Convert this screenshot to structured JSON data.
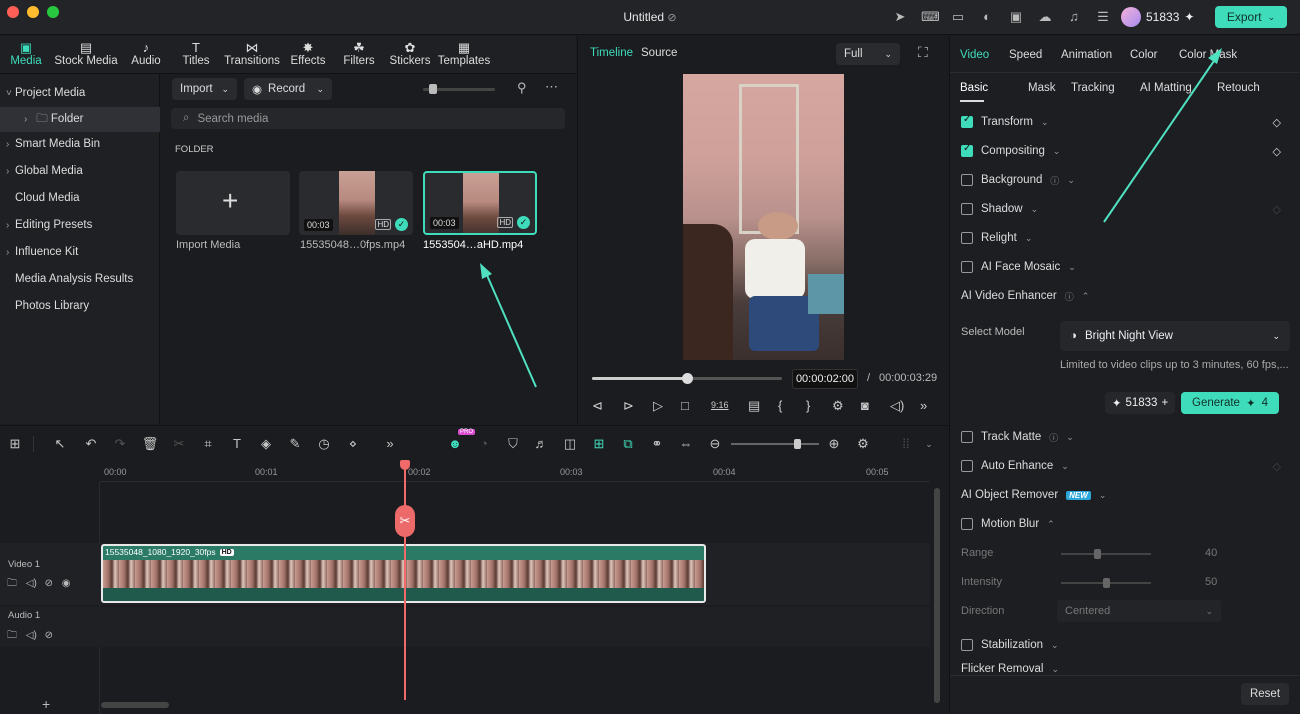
{
  "window": {
    "title": "Untitled",
    "credits": "51833",
    "export_label": "Export"
  },
  "media_tabs": [
    {
      "label": "Media",
      "icon": "media-icon"
    },
    {
      "label": "Stock Media",
      "icon": "stock-media-icon"
    },
    {
      "label": "Audio",
      "icon": "audio-icon"
    },
    {
      "label": "Titles",
      "icon": "titles-icon"
    },
    {
      "label": "Transitions",
      "icon": "transitions-icon"
    },
    {
      "label": "Effects",
      "icon": "effects-icon"
    },
    {
      "label": "Filters",
      "icon": "filters-icon"
    },
    {
      "label": "Stickers",
      "icon": "stickers-icon"
    },
    {
      "label": "Templates",
      "icon": "templates-icon"
    }
  ],
  "left_nav": [
    {
      "label": "Project Media",
      "caret": "˅"
    },
    {
      "label": "Folder",
      "caret": "›"
    },
    {
      "label": "Smart Media Bin",
      "caret": "›"
    },
    {
      "label": "Global Media",
      "caret": "›"
    },
    {
      "label": "Cloud Media",
      "caret": ""
    },
    {
      "label": "Editing Presets",
      "caret": "›"
    },
    {
      "label": "Influence Kit",
      "caret": "›"
    },
    {
      "label": "Media Analysis Results",
      "caret": ""
    },
    {
      "label": "Photos Library",
      "caret": ""
    }
  ],
  "media": {
    "import_label": "Import",
    "record_label": "Record",
    "search_placeholder": "Search media",
    "folder_heading": "FOLDER",
    "items": [
      {
        "label": "Import Media"
      },
      {
        "label": "15535048…0fps.mp4",
        "duration": "00:03"
      },
      {
        "label": "1553504…aHD.mp4",
        "duration": "00:03"
      }
    ]
  },
  "preview": {
    "tab_timeline": "Timeline",
    "tab_source": "Source",
    "zoom": "Full",
    "current_time": "00:00:02:00",
    "separator": "/",
    "total_time": "00:00:03:29",
    "aspect_label": "9:16",
    "progress": 0.5
  },
  "right_panel": {
    "tabs": [
      "Video",
      "Speed",
      "Animation",
      "Color",
      "Color Mask"
    ],
    "subtabs": [
      "Basic",
      "Mask",
      "Tracking",
      "AI Matting",
      "Retouch"
    ],
    "options": [
      {
        "label": "Transform",
        "checked": true
      },
      {
        "label": "Compositing",
        "checked": true
      },
      {
        "label": "Background",
        "checked": false
      },
      {
        "label": "Shadow",
        "checked": false
      },
      {
        "label": "Relight",
        "checked": false
      },
      {
        "label": "AI Face Mosaic",
        "checked": false
      }
    ],
    "enhancer": {
      "title": "AI Video Enhancer",
      "model_label": "Select Model",
      "model_value": "Bright Night View",
      "note": "Limited to video clips up to 3 minutes, 60 fps,...",
      "credits": "51833",
      "generate_label": "Generate",
      "generate_cost": "4"
    },
    "options2": [
      {
        "label": "Track Matte"
      },
      {
        "label": "Auto Enhance"
      }
    ],
    "object_remover": "AI Object Remover",
    "new_badge": "NEW",
    "motion_blur": {
      "label": "Motion Blur",
      "range_label": "Range",
      "range_value": "40",
      "range_level": 0.4,
      "intensity_label": "Intensity",
      "intensity_value": "50",
      "intensity_level": 0.5,
      "direction_label": "Direction",
      "direction_value": "Centered"
    },
    "stabilization": "Stabilization",
    "flicker": "Flicker Removal",
    "reset_label": "Reset"
  },
  "timeline": {
    "ruler": [
      "00:00",
      "00:01",
      "00:02",
      "00:03",
      "00:04",
      "00:05"
    ],
    "tracks": [
      {
        "label": "Video 1"
      },
      {
        "label": "Audio 1"
      }
    ],
    "clip_label": "15535048_1080_1920_30fps",
    "clip_badge": "HD",
    "pro_badge": "PRO",
    "zoom_level": 0.75
  }
}
